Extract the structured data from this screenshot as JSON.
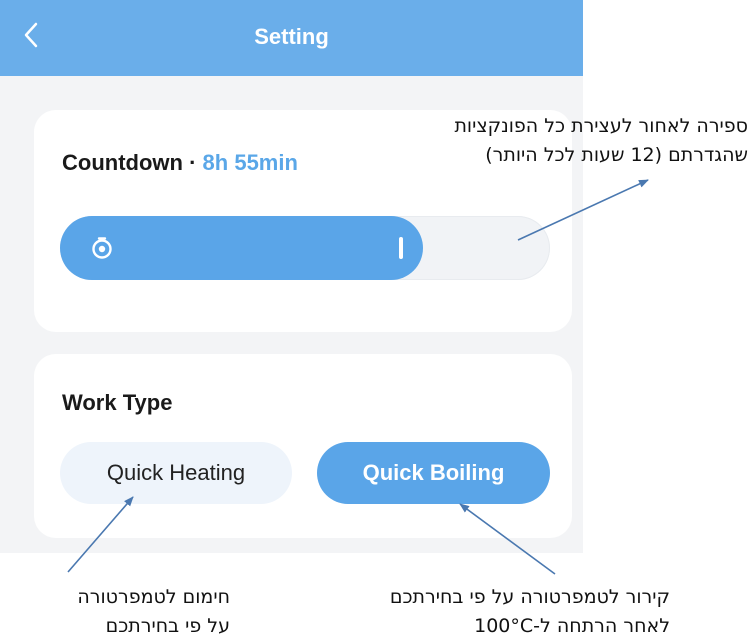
{
  "header": {
    "title": "Setting",
    "back_icon": "chevron-left-icon",
    "background": "#6aaeea"
  },
  "countdown": {
    "label": "Countdown",
    "separator": "·",
    "value": "8h 55min",
    "timer_icon": "timer-icon",
    "slider_fraction": 0.74,
    "accent": "#5aa5e8"
  },
  "work_type": {
    "label": "Work Type",
    "options": [
      {
        "label": "Quick Heating",
        "selected": false
      },
      {
        "label": "Quick Boiling",
        "selected": true
      }
    ]
  },
  "annotations": {
    "countdown": {
      "line1": "ספירה לאחור לעצירת כל הפונקציות",
      "line2": "שהגדרתם (12 שעות לכל היותר)"
    },
    "heating": {
      "line1": "חימום לטמפרטורה",
      "line2": "על פי בחירתכם"
    },
    "boiling": {
      "line1": "קירור לטמפרטורה על פי בחירתכם",
      "line2": "לאחר הרתחה ל-100°C"
    },
    "arrow_color": "#4a78b0"
  }
}
